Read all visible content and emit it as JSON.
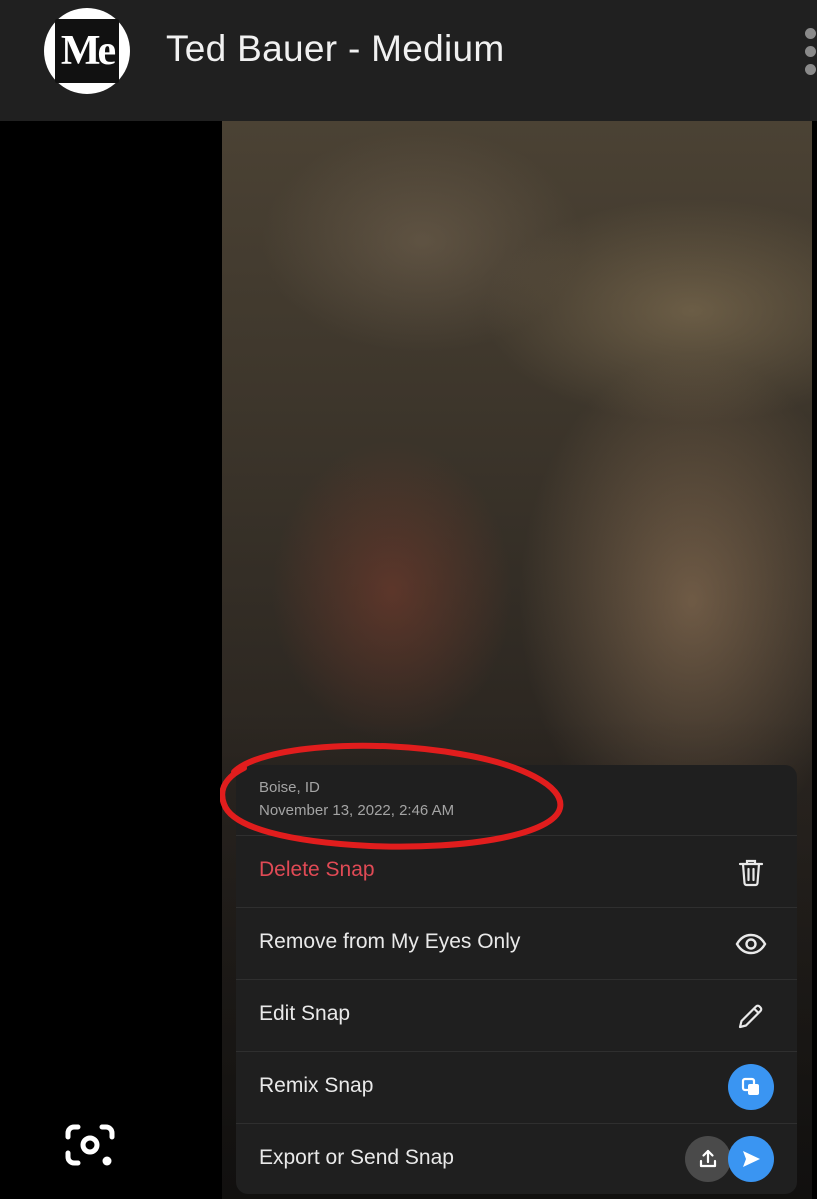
{
  "header": {
    "logo_text": "Me",
    "title": "Ted Bauer - Medium"
  },
  "colors": {
    "header_bg": "#202020",
    "menu_bg": "#1f1f1f",
    "danger": "#e04a55",
    "accent_blue": "#3a95f2",
    "annotation_red": "#e11d1d"
  },
  "snap_menu": {
    "location": "Boise, ID",
    "timestamp": "November 13, 2022, 2:46 AM",
    "items": [
      {
        "label": "Delete Snap",
        "icon": "trash-icon"
      },
      {
        "label": "Remove from My Eyes Only",
        "icon": "eye-icon"
      },
      {
        "label": "Edit Snap",
        "icon": "pencil-icon"
      },
      {
        "label": "Remix Snap",
        "icon": "remix-icon"
      },
      {
        "label": "Export or Send Snap",
        "icon": "share-send-icons"
      }
    ]
  },
  "lens_button": {
    "icon": "google-lens-icon"
  }
}
